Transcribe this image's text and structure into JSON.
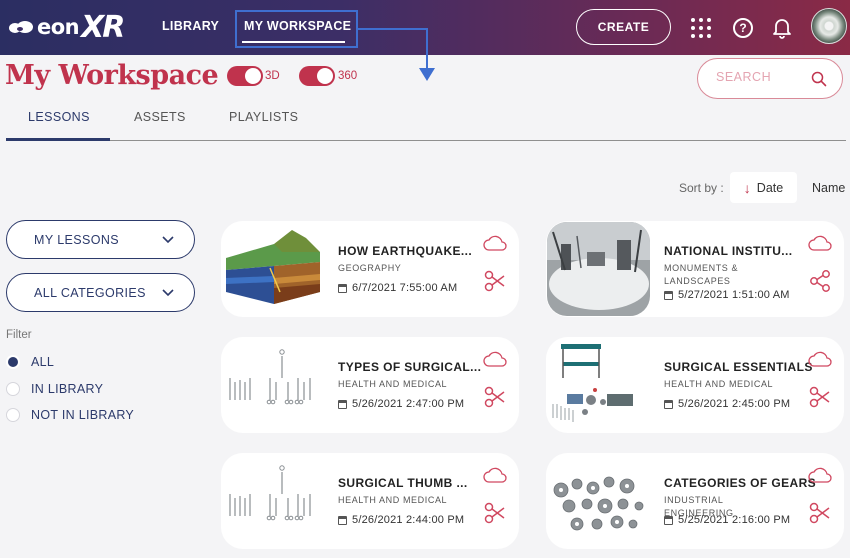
{
  "app": {
    "logo_text": "eon",
    "logo_suffix": "XR"
  },
  "nav": {
    "library_label": "LIBRARY",
    "workspace_label": "MY WORKSPACE",
    "create_label": "CREATE",
    "help_glyph": "?"
  },
  "header": {
    "title": "My Workspace",
    "toggle_3d_label": "3D",
    "toggle_360_label": "360",
    "toggle_3d_on": true,
    "toggle_360_on": true,
    "search_placeholder": "SEARCH"
  },
  "tabs": [
    {
      "label": "LESSONS",
      "active": true
    },
    {
      "label": "ASSETS",
      "active": false
    },
    {
      "label": "PLAYLISTS",
      "active": false
    }
  ],
  "sort": {
    "label": "Sort by :",
    "date_label": "Date",
    "name_label": "Name"
  },
  "sidebar": {
    "lessons_dropdown": "MY LESSONS",
    "categories_dropdown": "ALL CATEGORIES",
    "filter_label": "Filter",
    "filters": [
      {
        "label": "ALL",
        "checked": true
      },
      {
        "label": "IN LIBRARY",
        "checked": false
      },
      {
        "label": "NOT IN LIBRARY",
        "checked": false
      }
    ]
  },
  "lessons": [
    {
      "title": "HOW EARTHQUAKE...",
      "category": "GEOGRAPHY",
      "date": "6/7/2021 7:55:00 AM",
      "thumb": "earthquake-block"
    },
    {
      "title": "NATIONAL INSTITU...",
      "category": "MONUMENTS & LANDSCAPES",
      "date": "5/27/2021 1:51:00 AM",
      "thumb": "snow-panorama"
    },
    {
      "title": "TYPES OF SURGICAL...",
      "category": "HEALTH AND MEDICAL",
      "date": "5/26/2021 2:47:00 PM",
      "thumb": "surgical-instruments"
    },
    {
      "title": "SURGICAL ESSENTIALS",
      "category": "HEALTH AND MEDICAL",
      "date": "5/26/2021 2:45:00 PM",
      "thumb": "surgical-cart"
    },
    {
      "title": "SURGICAL THUMB ...",
      "category": "HEALTH AND MEDICAL",
      "date": "5/26/2021 2:44:00 PM",
      "thumb": "surgical-instruments"
    },
    {
      "title": "CATEGORIES OF GEARS",
      "category": "INDUSTRIAL ENGINEERING",
      "date": "5/25/2021 2:16:00 PM",
      "thumb": "gears"
    }
  ],
  "colors": {
    "accent": "#c0334d",
    "navy": "#2c3a6b",
    "highlight": "#3f6fd0"
  },
  "icons": [
    "grid-icon",
    "help-icon",
    "bell-icon",
    "search-icon",
    "chevron-down-icon",
    "cloud-icon",
    "share-icon",
    "calendar-icon",
    "arrow-down-icon"
  ]
}
